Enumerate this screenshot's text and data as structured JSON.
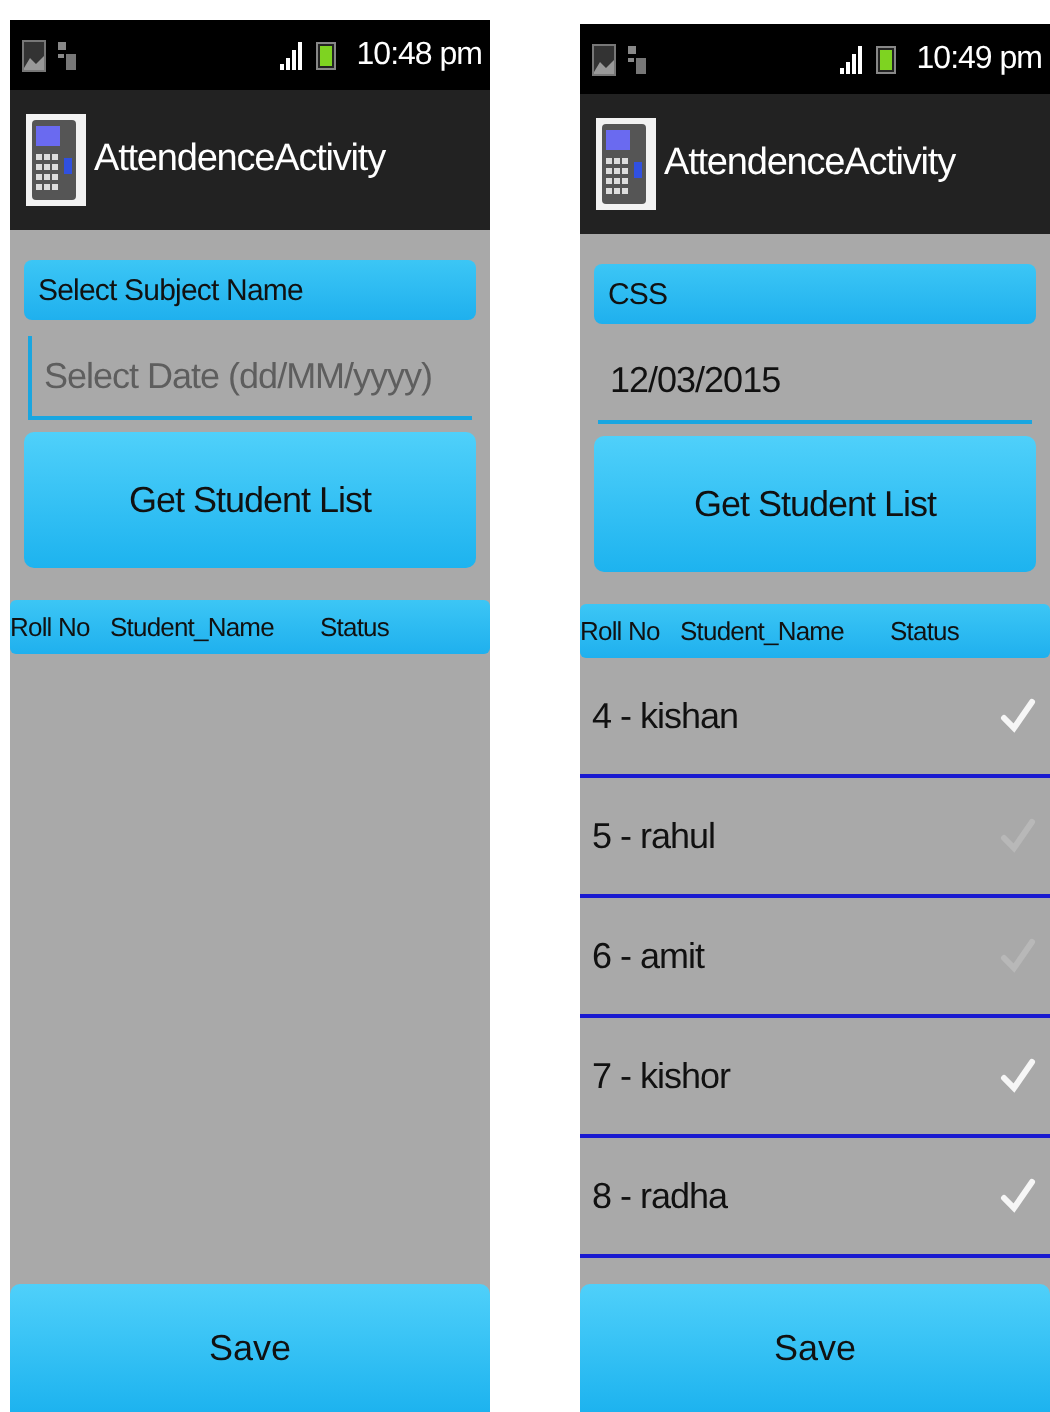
{
  "screens": [
    {
      "status_bar": {
        "time": "10:48 pm"
      },
      "title": "AttendenceActivity",
      "subject": "Select Subject Name",
      "date": {
        "placeholder": "Select Date (dd/MM/yyyy)",
        "focused": true
      },
      "get_button": "Get Student List",
      "columns": [
        "Roll No",
        "Student_Name",
        "Status"
      ],
      "save_button": "Save"
    },
    {
      "status_bar": {
        "time": "10:49 pm"
      },
      "title": "AttendenceActivity",
      "subject": "CSS",
      "date": {
        "value": "12/03/2015",
        "focused": false
      },
      "get_button": "Get Student List",
      "columns": [
        "Roll No",
        "Student_Name",
        "Status"
      ],
      "rows": [
        {
          "label": "4 - kishan",
          "checked": true
        },
        {
          "label": "5 - rahul",
          "checked": false
        },
        {
          "label": "6 - amit",
          "checked": false
        },
        {
          "label": "7 - kishor",
          "checked": true
        },
        {
          "label": "8 - radha",
          "checked": true
        }
      ],
      "save_button": "Save"
    }
  ]
}
